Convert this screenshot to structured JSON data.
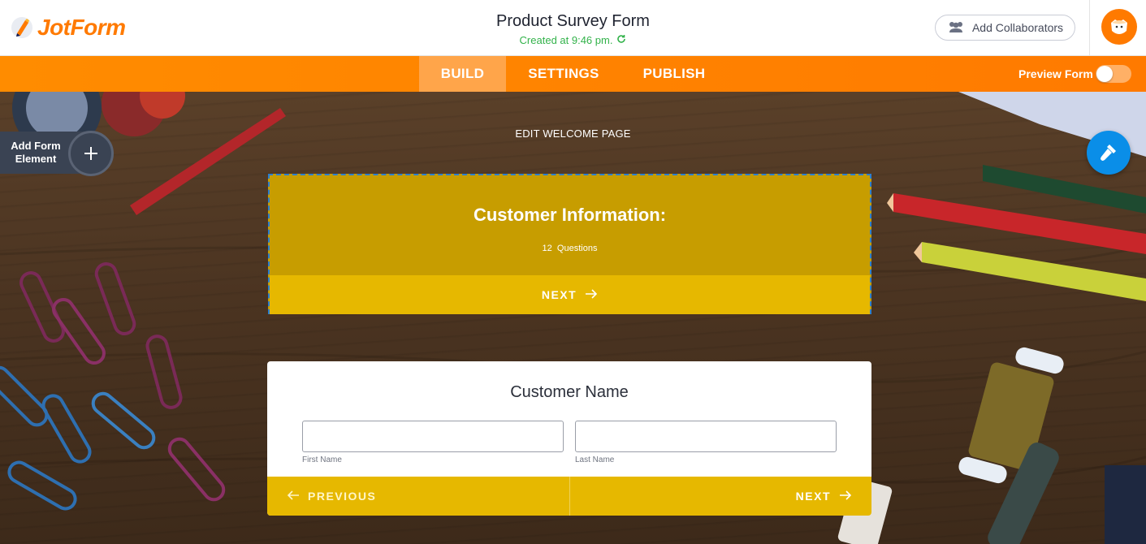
{
  "header": {
    "logo_text": "JotForm",
    "form_title": "Product Survey Form",
    "created_text": "Created at 9:46 pm.",
    "collaborators_label": "Add Collaborators"
  },
  "nav": {
    "tabs": [
      {
        "label": "BUILD",
        "active": true
      },
      {
        "label": "SETTINGS",
        "active": false
      },
      {
        "label": "PUBLISH",
        "active": false
      }
    ],
    "preview_label": "Preview Form",
    "preview_enabled": false
  },
  "builder": {
    "add_element_label": "Add Form Element",
    "edit_welcome_label": "EDIT WELCOME PAGE"
  },
  "welcome": {
    "title": "Customer Information:",
    "questions_count": "12",
    "questions_label": "Questions",
    "next_label": "NEXT"
  },
  "question": {
    "title": "Customer Name",
    "first_name_value": "",
    "first_name_sublabel": "First Name",
    "last_name_value": "",
    "last_name_sublabel": "Last Name",
    "previous_label": "PREVIOUS",
    "next_label": "NEXT"
  },
  "colors": {
    "brand_orange": "#ff7a00",
    "card_gold": "#c79d00",
    "button_gold": "#e6b800",
    "accent_blue": "#0a8ee8",
    "success_green": "#32b24a"
  },
  "icons": [
    "jotform-logo-icon",
    "refresh-icon",
    "users-icon",
    "avatar-icon",
    "plus-icon",
    "paint-brush-icon",
    "arrow-right-icon",
    "arrow-left-icon"
  ]
}
